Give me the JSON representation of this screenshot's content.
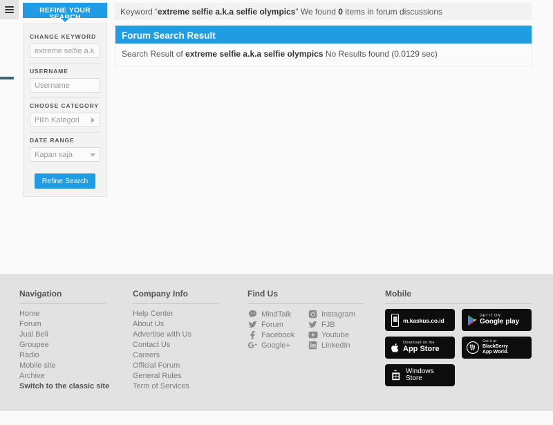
{
  "topbar": {
    "menu_icon": "hamburger-icon"
  },
  "sidebar": {
    "tab_label": "REFINE YOUR SEARCH",
    "fields": [
      {
        "label": "CHANGE KEYWORD",
        "name": "keyword",
        "placeholder": "extreme selfie a.k.a selfie olympics",
        "value": "",
        "control": "text"
      },
      {
        "label": "USERNAME",
        "name": "username",
        "placeholder": "Username",
        "value": "",
        "control": "text"
      },
      {
        "label": "CHOOSE CATEGORY",
        "name": "category",
        "placeholder": "Pilih Kategori",
        "value": "",
        "control": "select-right"
      },
      {
        "label": "DATE RANGE",
        "name": "date_range",
        "placeholder": "Kapan saja",
        "value": "",
        "control": "select-down"
      }
    ],
    "submit_label": "Refine Search"
  },
  "main": {
    "keyword_bar": {
      "prefix": "Keyword “",
      "keyword": "extreme selfie a.k.a selfie olympics",
      "middle": "” We found ",
      "count": "0",
      "suffix": " items in forum discussions"
    },
    "result_header": "Forum Search Result",
    "result_body": {
      "prefix": "Search Result of ",
      "keyword": "extreme selfie a.k.a selfie olympics",
      "suffix": " No Results found (0.0129 sec)"
    }
  },
  "footer": {
    "navigation": {
      "title": "Navigation",
      "links": [
        {
          "label": "Home",
          "strong": false
        },
        {
          "label": "Forum",
          "strong": false
        },
        {
          "label": "Jual Beli",
          "strong": false
        },
        {
          "label": "Groupee",
          "strong": false
        },
        {
          "label": "Radio",
          "strong": false
        },
        {
          "label": "Mobile site",
          "strong": false
        },
        {
          "label": "Archive",
          "strong": false
        },
        {
          "label": "Switch to the classic site",
          "strong": true
        }
      ]
    },
    "company": {
      "title": "Company Info",
      "links": [
        {
          "label": "Help Center"
        },
        {
          "label": "About Us"
        },
        {
          "label": "Advertise with Us"
        },
        {
          "label": "Contact Us"
        },
        {
          "label": "Careers"
        },
        {
          "label": "Official Forum"
        },
        {
          "label": "General Rules"
        },
        {
          "label": "Term of Services"
        }
      ]
    },
    "find_us": {
      "title": "Find Us",
      "items": [
        {
          "label": "MindTalk",
          "icon": "mindtalk-icon"
        },
        {
          "label": "Instagram",
          "icon": "instagram-icon"
        },
        {
          "label": "Forum",
          "icon": "twitter-icon"
        },
        {
          "label": "FJB",
          "icon": "twitter-icon"
        },
        {
          "label": "Facebook",
          "icon": "facebook-icon"
        },
        {
          "label": "Youtube",
          "icon": "youtube-icon"
        },
        {
          "label": "Google+",
          "icon": "googleplus-icon"
        },
        {
          "label": "LinkedIn",
          "icon": "linkedin-icon"
        }
      ]
    },
    "mobile": {
      "title": "Mobile",
      "badges": [
        {
          "icon": "mobile-phone-icon",
          "line1": "",
          "line2": "m.kaskus.co.id"
        },
        {
          "icon": "google-play-icon",
          "line1": "GET IT ON",
          "line2": "Google play"
        },
        {
          "icon": "apple-icon",
          "line1": "Download on the",
          "line2": "App Store"
        },
        {
          "icon": "blackberry-icon",
          "line1": "Get it at",
          "line2": "BlackBerry App World."
        },
        {
          "icon": "windows-icon",
          "line1": "",
          "line2": "Windows Store"
        }
      ]
    }
  },
  "colors": {
    "accent_blue": "#1f9ce4",
    "footer_bg": "#e2e2e2",
    "page_bg": "#fafafa"
  }
}
